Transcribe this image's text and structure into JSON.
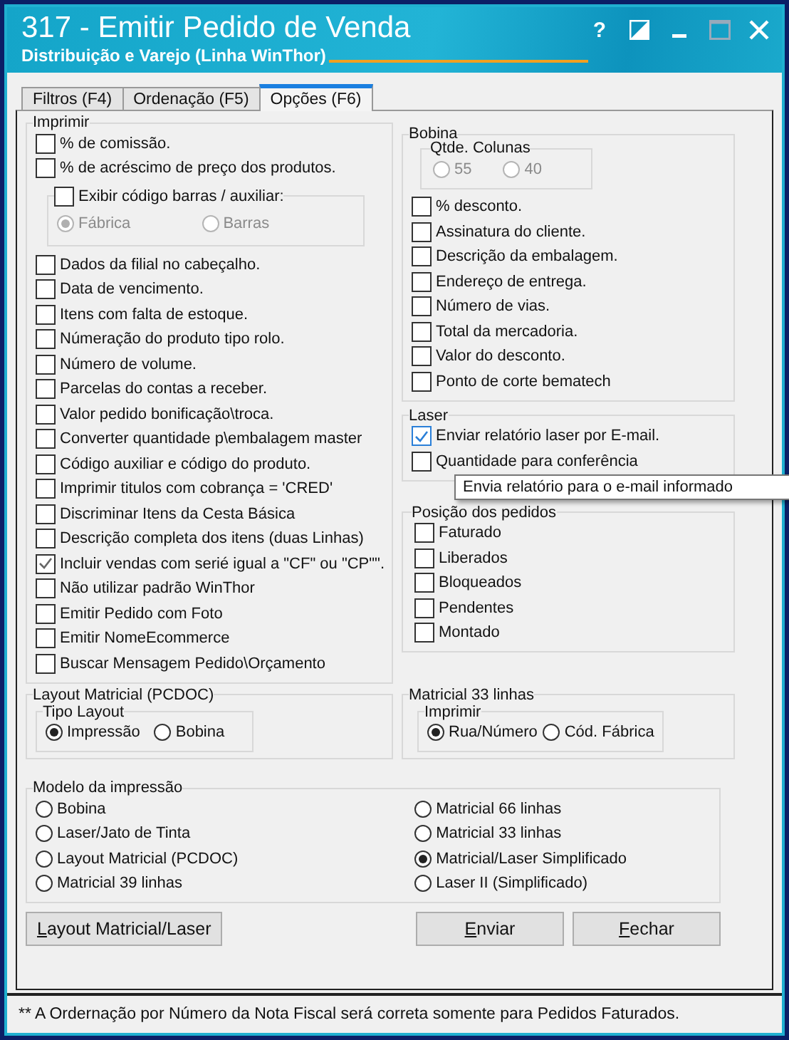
{
  "window": {
    "title": "317 - Emitir Pedido de Venda",
    "subtitle": "Distribuição e Varejo (Linha WinThor)",
    "controls": [
      {
        "kind": "help",
        "glyph": "?",
        "disabled": false
      },
      {
        "kind": "contrast",
        "disabled": false
      },
      {
        "kind": "minimize",
        "disabled": false
      },
      {
        "kind": "maximize",
        "disabled": true
      },
      {
        "kind": "close",
        "disabled": false
      }
    ]
  },
  "tabs": [
    {
      "label": "Filtros (F4)",
      "selected": false
    },
    {
      "label": "Ordenação (F5)",
      "selected": false
    },
    {
      "label": "Opções (F6)",
      "selected": true
    }
  ],
  "imprimir": {
    "label": "Imprimir",
    "items": [
      {
        "kind": "checkbox",
        "label": "% de comissão.",
        "checked": false
      },
      {
        "kind": "checkbox",
        "label": "% de acréscimo de preço dos produtos.",
        "checked": false
      },
      {
        "kind": "subgroup",
        "label": "Exibir código barras / auxiliar:",
        "checked": false,
        "options": [
          {
            "label": "Fábrica",
            "selected": true,
            "disabled": true
          },
          {
            "label": "Barras",
            "selected": false,
            "disabled": true
          }
        ]
      },
      {
        "kind": "checkbox",
        "label": "Dados da filial no cabeçalho.",
        "checked": false
      },
      {
        "kind": "checkbox",
        "label": "Data de vencimento.",
        "checked": false
      },
      {
        "kind": "checkbox",
        "label": "Itens com falta de estoque.",
        "checked": false
      },
      {
        "kind": "checkbox",
        "label": "Númeração do produto tipo rolo.",
        "checked": false
      },
      {
        "kind": "checkbox",
        "label": "Número de volume.",
        "checked": false
      },
      {
        "kind": "checkbox",
        "label": "Parcelas do contas a receber.",
        "checked": false
      },
      {
        "kind": "checkbox",
        "label": "Valor pedido bonificação\\troca.",
        "checked": false
      },
      {
        "kind": "checkbox",
        "label": "Converter quantidade p\\embalagem master",
        "checked": false
      },
      {
        "kind": "checkbox",
        "label": "Código auxiliar e código do produto.",
        "checked": false
      },
      {
        "kind": "checkbox",
        "label": "Imprimir titulos com cobrança =  'CRED'",
        "checked": false
      },
      {
        "kind": "checkbox",
        "label": "Discriminar Itens da Cesta Básica",
        "checked": false
      },
      {
        "kind": "checkbox",
        "label": "Descrição completa dos itens (duas Linhas)",
        "checked": false
      },
      {
        "kind": "checkbox",
        "label": "Incluir vendas com serié igual a \"CF\" ou \"CP\"\".",
        "checked": true
      },
      {
        "kind": "checkbox",
        "label": "Não utilizar padrão WinThor",
        "checked": false
      },
      {
        "kind": "checkbox",
        "label": "Emitir Pedido com Foto",
        "checked": false
      },
      {
        "kind": "checkbox",
        "label": "Emitir NomeEcommerce",
        "checked": false
      },
      {
        "kind": "checkbox",
        "label": "Buscar Mensagem Pedido\\Orçamento",
        "checked": false
      }
    ]
  },
  "layout_matricial": {
    "label": "Layout Matricial (PCDOC)",
    "sublabel": "Tipo Layout",
    "options": [
      {
        "label": "Impressão",
        "selected": true
      },
      {
        "label": "Bobina",
        "selected": false
      }
    ]
  },
  "bobina": {
    "label": "Bobina",
    "columns": {
      "label": "Qtde. Colunas",
      "options": [
        {
          "label": "55",
          "selected": false,
          "disabled": true
        },
        {
          "label": "40",
          "selected": false,
          "disabled": true
        }
      ]
    },
    "items": [
      {
        "label": "% desconto.",
        "checked": false
      },
      {
        "label": "Assinatura do cliente.",
        "checked": false
      },
      {
        "label": "Descrição da embalagem.",
        "checked": false
      },
      {
        "label": "Endereço de entrega.",
        "checked": false
      },
      {
        "label": "Número de vias.",
        "checked": false
      },
      {
        "label": "Total da mercadoria.",
        "checked": false
      },
      {
        "label": "Valor do desconto.",
        "checked": false
      },
      {
        "label": "Ponto de corte bematech",
        "checked": false
      }
    ]
  },
  "laser": {
    "label": "Laser",
    "items": [
      {
        "label": "Enviar relatório laser por E-mail.",
        "checked": true,
        "hovered": true
      },
      {
        "label": "Quantidade para conferência",
        "checked": false
      }
    ]
  },
  "tooltip": {
    "text": "Envia relatório para o e-mail informado"
  },
  "posicao": {
    "label": "Posição dos pedidos",
    "items": [
      {
        "label": "Faturado",
        "checked": false
      },
      {
        "label": "Liberados",
        "checked": false
      },
      {
        "label": "Bloqueados",
        "checked": false
      },
      {
        "label": "Pendentes",
        "checked": false
      },
      {
        "label": "Montado",
        "checked": false
      }
    ]
  },
  "matricial_33": {
    "label": "Matricial 33 linhas",
    "sublabel": "Imprimir",
    "options": [
      {
        "label": "Rua/Número",
        "selected": true
      },
      {
        "label": "Cód. Fábrica",
        "selected": false
      }
    ]
  },
  "modelo": {
    "label": "Modelo da impressão",
    "columns": [
      {
        "options": [
          {
            "label": "Bobina",
            "selected": false
          },
          {
            "label": "Laser/Jato de Tinta",
            "selected": false
          },
          {
            "label": "Layout Matricial (PCDOC)",
            "selected": false
          },
          {
            "label": "Matricial 39 linhas",
            "selected": false
          }
        ]
      },
      {
        "options": [
          {
            "label": "Matricial 66 linhas",
            "selected": false
          },
          {
            "label": "Matricial 33 linhas",
            "selected": false
          },
          {
            "label": "Matricial/Laser Simplificado",
            "selected": true
          },
          {
            "label": "Laser II (Simplificado)",
            "selected": false
          }
        ]
      }
    ]
  },
  "buttons": {
    "left": [
      {
        "label": "Layout Matricial/Laser"
      }
    ],
    "right": [
      {
        "label": "Enviar"
      },
      {
        "label": "Fechar"
      }
    ]
  },
  "status_bar": {
    "text": "** A Ordernação por Número da Nota Fiscal será correta somente para Pedidos Faturados."
  }
}
